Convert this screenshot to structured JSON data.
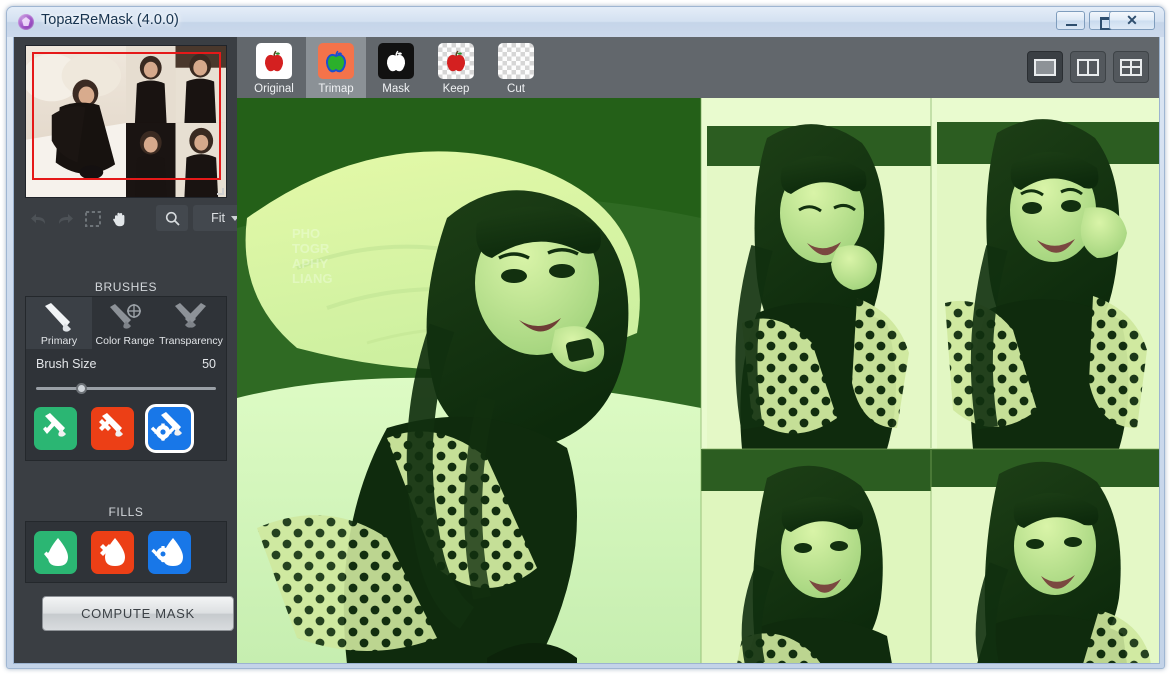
{
  "window": {
    "title": "TopazReMask (4.0.0)",
    "icon": "topaz-logo-icon",
    "controls": {
      "minimize_label": "",
      "maximize_label": "",
      "close_label": "✕"
    }
  },
  "navigator": {
    "name": "navigator-thumbnail",
    "selection_color": "#e51919"
  },
  "toolbar": {
    "undo_icon": "undo-arrow-icon",
    "redo_icon": "redo-arrow-icon",
    "marquee_icon": "marquee-select-icon",
    "hand_icon": "hand-pan-icon",
    "zoom_icon": "magnifier-icon",
    "zoom_level": "Fit"
  },
  "tabs": [
    {
      "id": "original",
      "label": "Original",
      "icon": "red-apple-icon",
      "active": false
    },
    {
      "id": "trimap",
      "label": "Trimap",
      "icon": "trimap-apple-icon",
      "active": true
    },
    {
      "id": "mask",
      "label": "Mask",
      "icon": "white-apple-on-black-icon",
      "active": false
    },
    {
      "id": "keep",
      "label": "Keep",
      "icon": "apple-on-checker-icon",
      "active": false
    },
    {
      "id": "cut",
      "label": "Cut",
      "icon": "empty-checker-icon",
      "active": false
    }
  ],
  "view_modes": [
    {
      "id": "single",
      "icon": "single-pane-icon",
      "active": true
    },
    {
      "id": "split2",
      "icon": "two-pane-icon",
      "active": false
    },
    {
      "id": "quad",
      "icon": "four-pane-icon",
      "active": false
    }
  ],
  "brushes": {
    "section_label": "BRUSHES",
    "tabs": [
      {
        "id": "primary",
        "label": "Primary",
        "icon": "paintbrush-icon",
        "active": true
      },
      {
        "id": "color-range",
        "label": "Color Range",
        "icon": "brush-color-range-icon",
        "active": false
      },
      {
        "id": "transparency",
        "label": "Transparency",
        "icon": "brush-transparency-icon",
        "active": false
      }
    ],
    "brush_size_label": "Brush Size",
    "brush_size_value": "50",
    "brush_size_percent": 22,
    "buttons": [
      {
        "id": "keep-brush",
        "icon": "brush-check-icon",
        "color": "#2bb673",
        "selected": false
      },
      {
        "id": "cut-brush",
        "icon": "brush-cross-icon",
        "color": "#ec3f16",
        "selected": false
      },
      {
        "id": "compute-brush",
        "icon": "brush-gear-icon",
        "color": "#1877e8",
        "selected": true
      }
    ]
  },
  "fills": {
    "section_label": "FILLS",
    "buttons": [
      {
        "id": "keep-fill",
        "icon": "droplet-check-icon",
        "color": "#2bb673",
        "selected": false
      },
      {
        "id": "cut-fill",
        "icon": "droplet-cross-icon",
        "color": "#ec3f16",
        "selected": false
      },
      {
        "id": "compute-fill",
        "icon": "droplet-gear-icon",
        "color": "#1877e8",
        "selected": false
      }
    ]
  },
  "compute_mask_label": "COMPUTE MASK",
  "canvas": {
    "name": "image-canvas",
    "overlay_mode": "trimap-green",
    "watermark": "LIANG"
  }
}
